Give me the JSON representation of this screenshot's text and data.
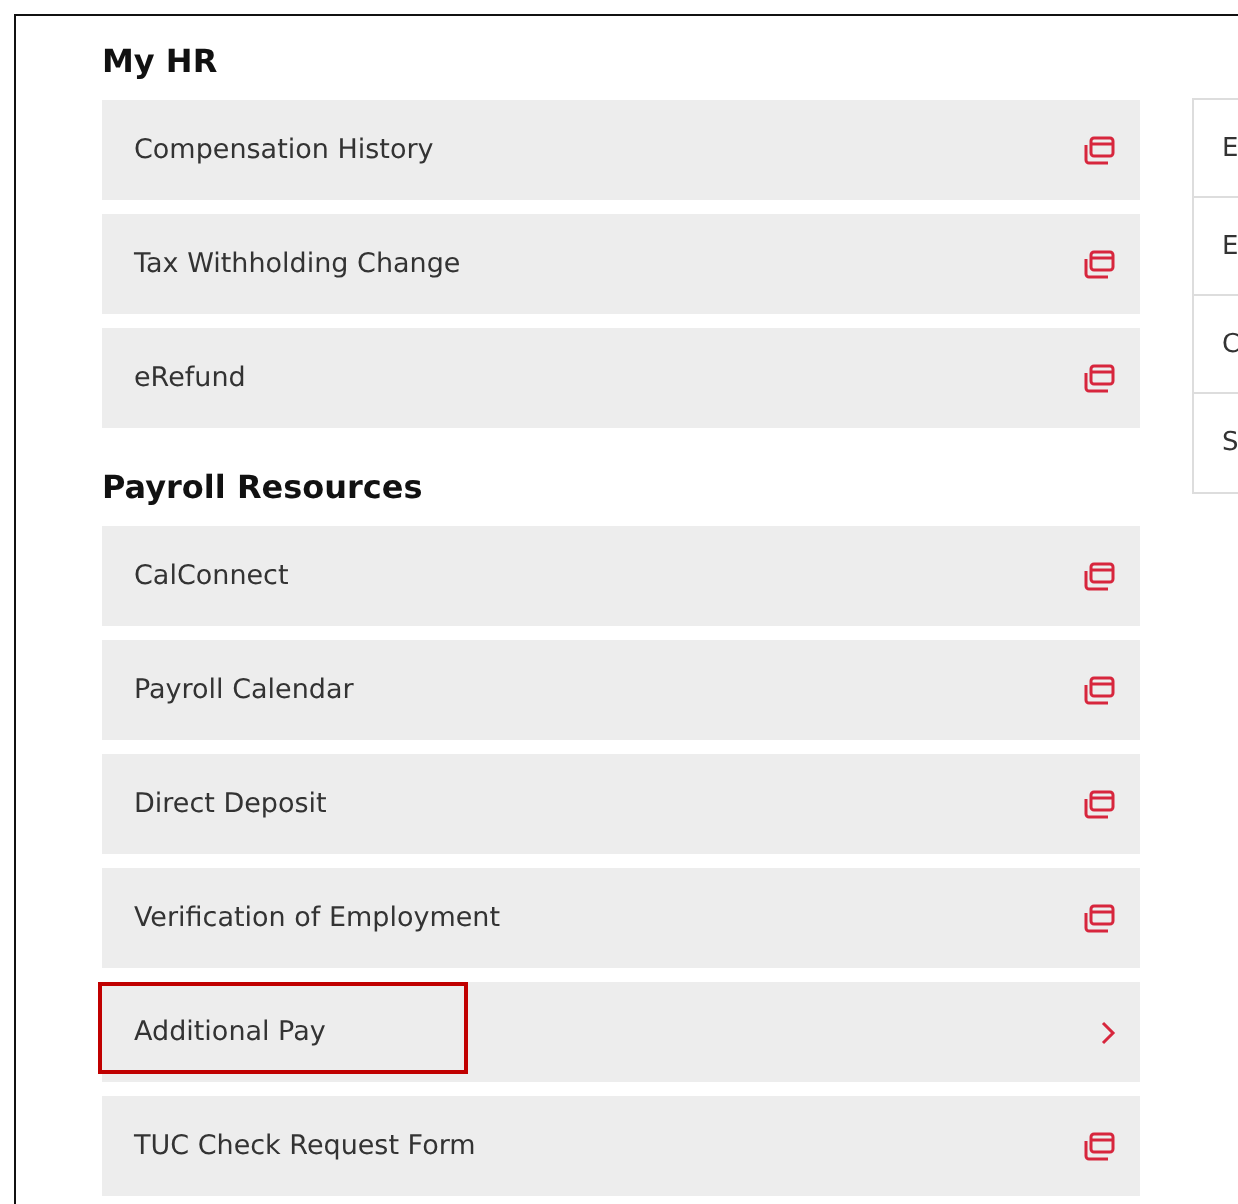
{
  "sections": [
    {
      "title": "My HR",
      "items": [
        {
          "label": "Compensation History",
          "kind": "external",
          "highlighted": false
        },
        {
          "label": "Tax Withholding Change",
          "kind": "external",
          "highlighted": false
        },
        {
          "label": "eRefund",
          "kind": "external",
          "highlighted": false
        }
      ]
    },
    {
      "title": "Payroll Resources",
      "items": [
        {
          "label": "CalConnect",
          "kind": "external",
          "highlighted": false
        },
        {
          "label": "Payroll Calendar",
          "kind": "external",
          "highlighted": false
        },
        {
          "label": "Direct Deposit",
          "kind": "external",
          "highlighted": false
        },
        {
          "label": "Verification of Employment",
          "kind": "external",
          "highlighted": false
        },
        {
          "label": "Additional Pay",
          "kind": "internal",
          "highlighted": true
        },
        {
          "label": "TUC Check Request Form",
          "kind": "external",
          "highlighted": false
        }
      ]
    }
  ],
  "side_menu": [
    "E",
    "E",
    "C",
    "S"
  ]
}
